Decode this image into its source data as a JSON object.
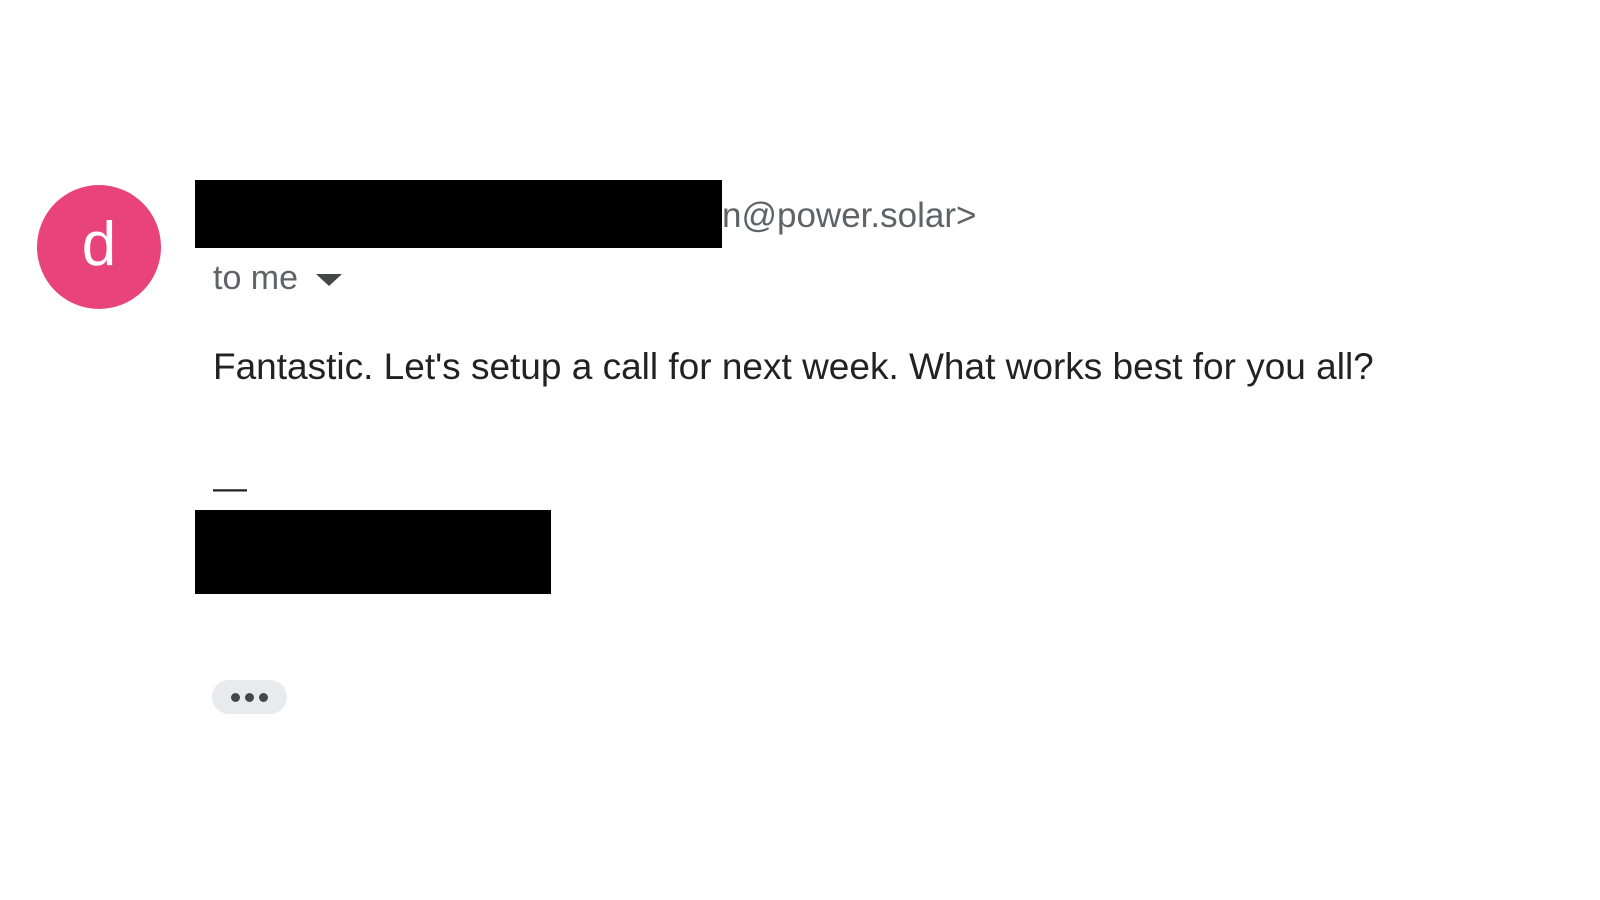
{
  "sender": {
    "avatar_letter": "d",
    "avatar_color": "#e8437b",
    "email_visible_part": "n@power.solar>"
  },
  "recipient": {
    "label": "to me",
    "dropdown_icon": "caret-down-icon"
  },
  "message": {
    "body": "Fantastic. Let's setup a call for next week. What works best for you all?",
    "signature_dash": "—"
  },
  "actions": {
    "expand_icon": "more-horizontal-icon"
  }
}
